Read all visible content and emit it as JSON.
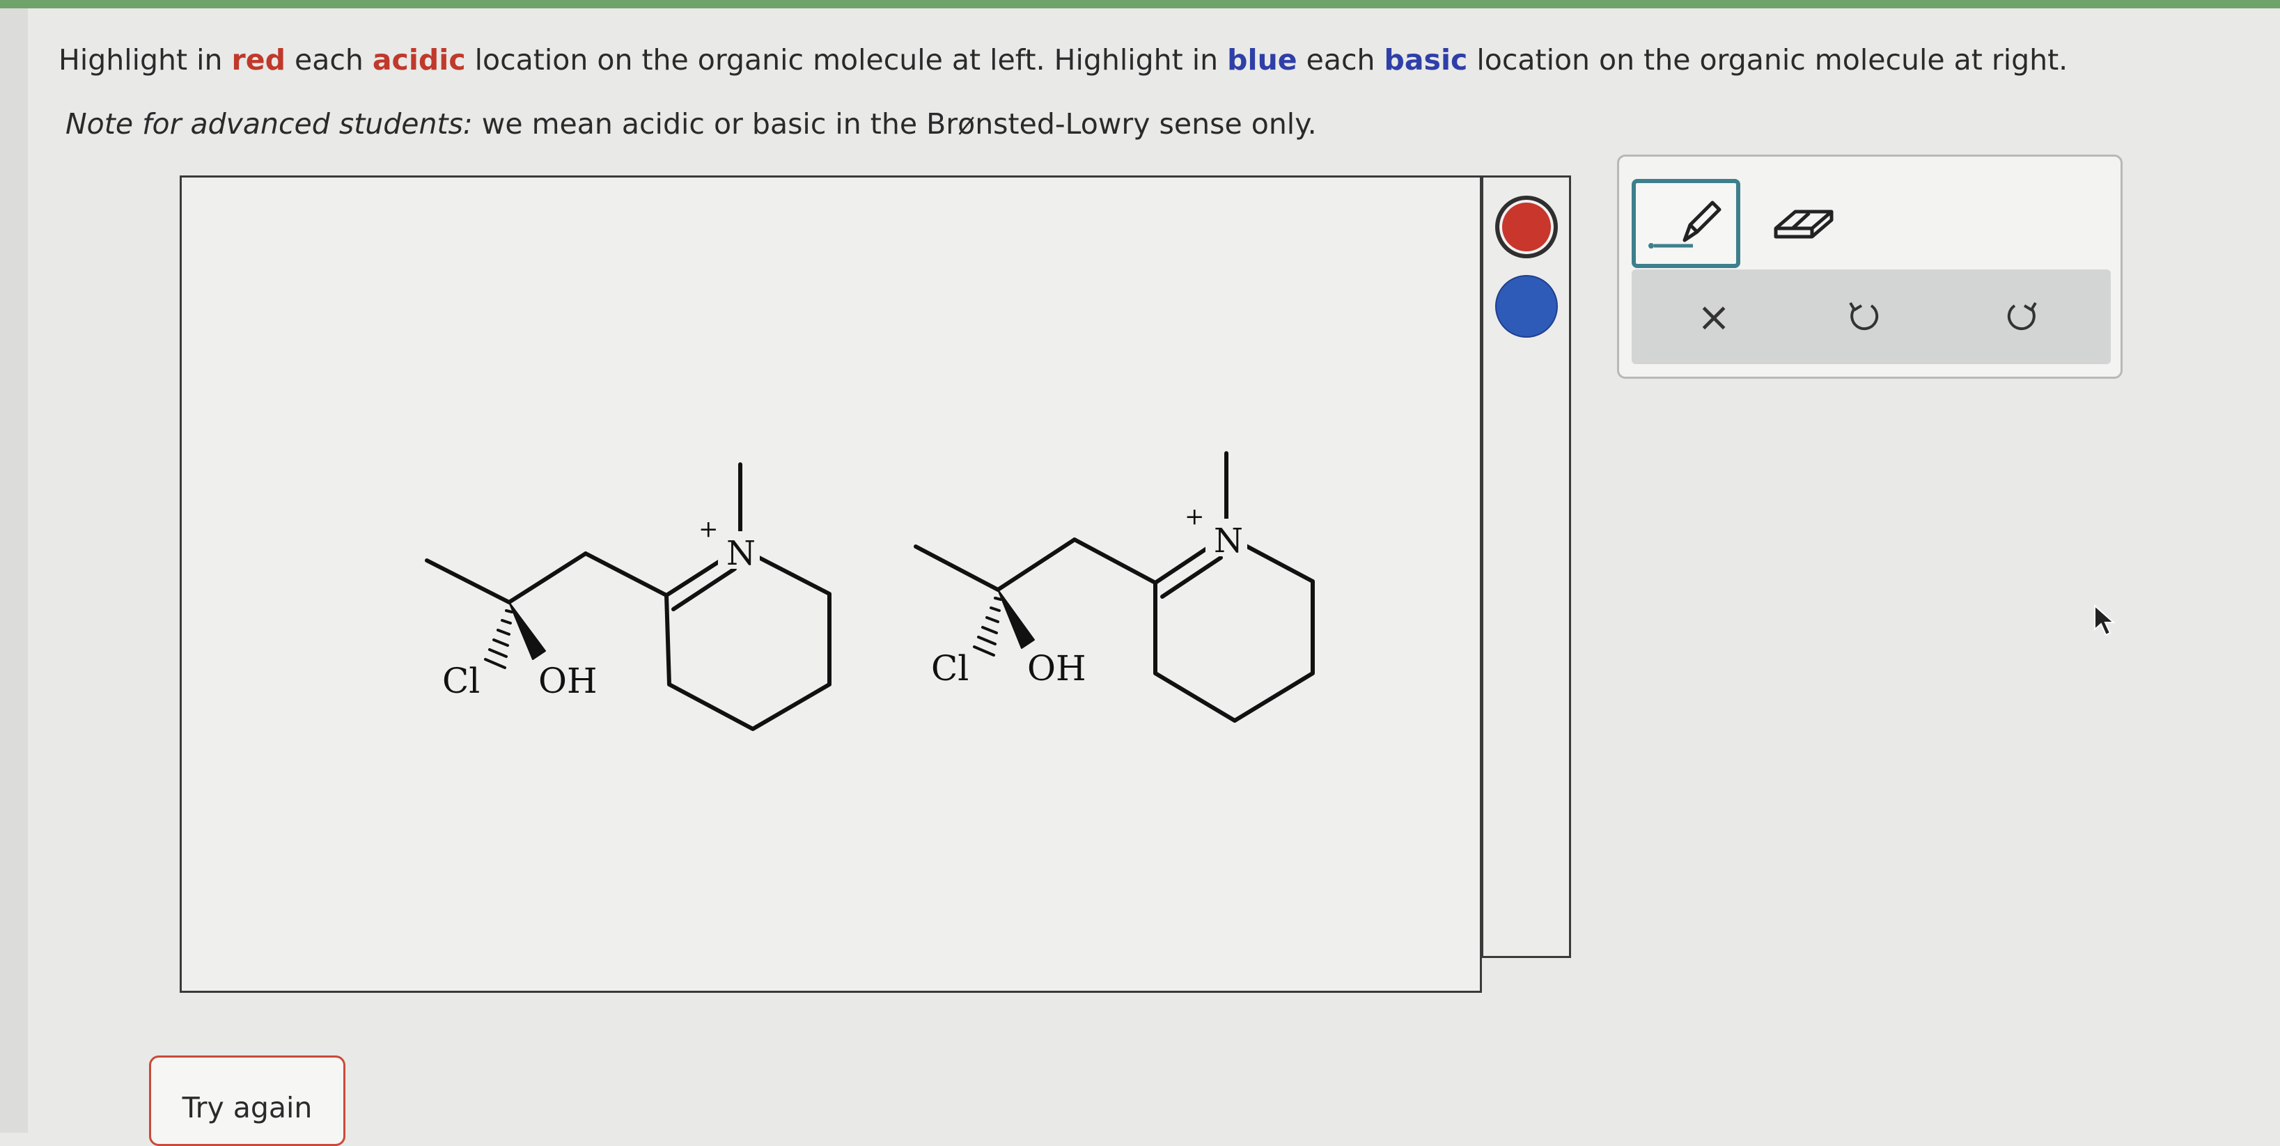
{
  "instructions": {
    "p1": "Highlight in ",
    "red_word": "red",
    "p2": " each ",
    "acidic_word": "acidic",
    "p3": " location on the organic molecule at left. Highlight in ",
    "blue_word": "blue",
    "p4": " each ",
    "basic_word": "basic",
    "p5": " location on the organic molecule at right."
  },
  "note": {
    "lead": "Note for advanced students:",
    "body": " we mean acidic or basic in the Brønsted-Lowry sense only."
  },
  "molecules": {
    "left": {
      "cl": "Cl",
      "oh": "OH",
      "n": "N",
      "charge": "+"
    },
    "right": {
      "cl": "Cl",
      "oh": "OH",
      "n": "N",
      "charge": "+"
    }
  },
  "palette": {
    "colors": {
      "red": "#c8362c",
      "blue": "#2f5bb8"
    }
  },
  "tools": {
    "pencil_icon": "pencil-icon",
    "eraser_icon": "eraser-icon",
    "clear_glyph": "×",
    "undo_icon": "undo-icon",
    "redo_icon": "redo-icon"
  },
  "buttons": {
    "try_again": "Try again"
  }
}
